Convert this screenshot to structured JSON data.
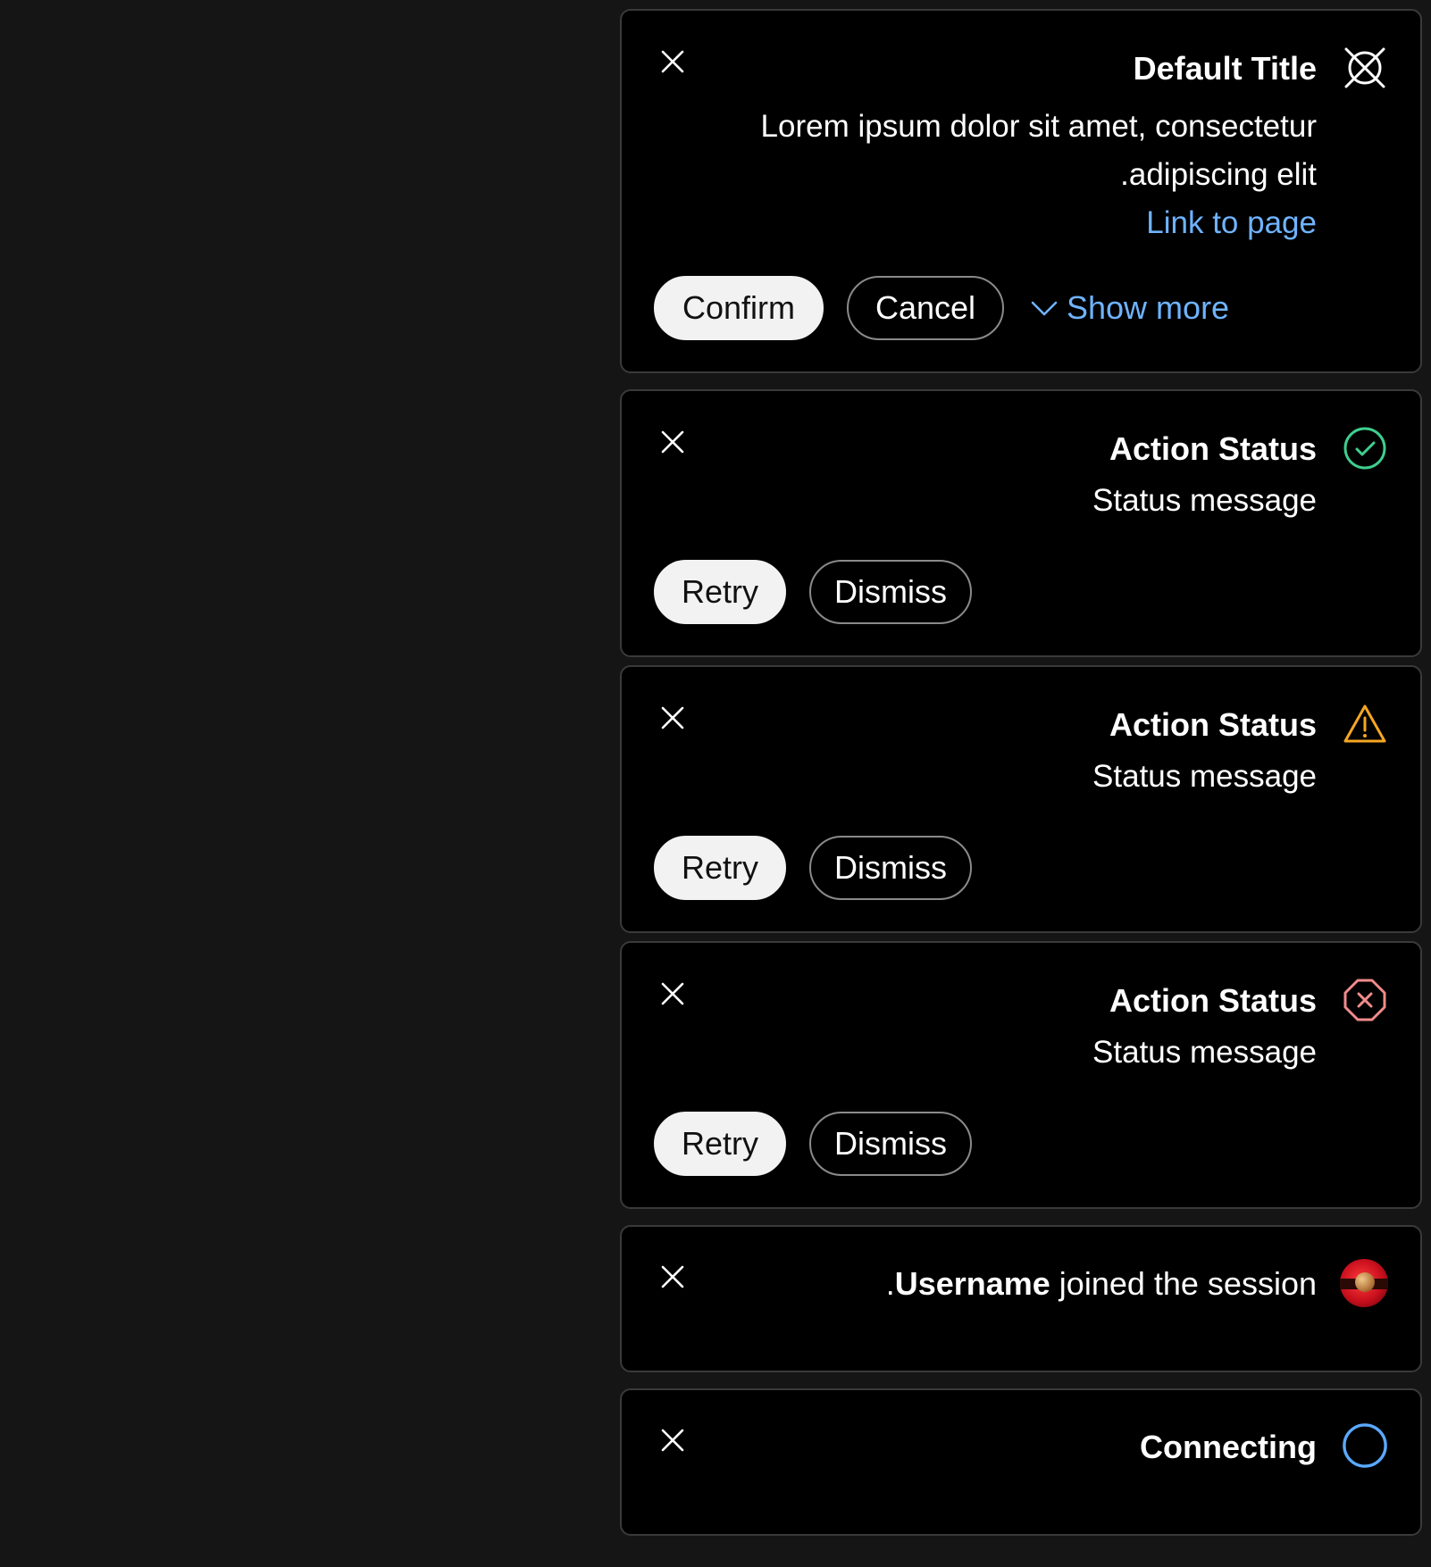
{
  "toasts": [
    {
      "title": "Default Title",
      "icon": "default-status-icon",
      "body_line1": "Lorem ipsum dolor sit amet, consectetur",
      "body_line2": ".adipiscing elit",
      "link": "Link to page",
      "primary_label": "Confirm",
      "secondary_label": "Cancel",
      "show_more_label": "Show more"
    },
    {
      "title": "Action Status",
      "icon": "success-check-icon",
      "icon_color": "#3ecf8e",
      "message": "Status message",
      "primary_label": "Retry",
      "secondary_label": "Dismiss"
    },
    {
      "title": "Action Status",
      "icon": "warning-triangle-icon",
      "icon_color": "#f5a623",
      "message": "Status message",
      "primary_label": "Retry",
      "secondary_label": "Dismiss"
    },
    {
      "title": "Action Status",
      "icon": "error-octagon-icon",
      "icon_color": "#f28b8b",
      "message": "Status message",
      "primary_label": "Retry",
      "secondary_label": "Dismiss"
    },
    {
      "prefix": ".",
      "username": "Username",
      "suffix": " joined the session",
      "icon": "avatar"
    },
    {
      "title": "Connecting",
      "icon": "loading-circle-icon",
      "icon_color": "#5aa9ff"
    }
  ],
  "colors": {
    "page_background": "#151515",
    "toast_background": "#000000",
    "toast_border": "#3a3a3a",
    "link": "#6fb3ff"
  }
}
